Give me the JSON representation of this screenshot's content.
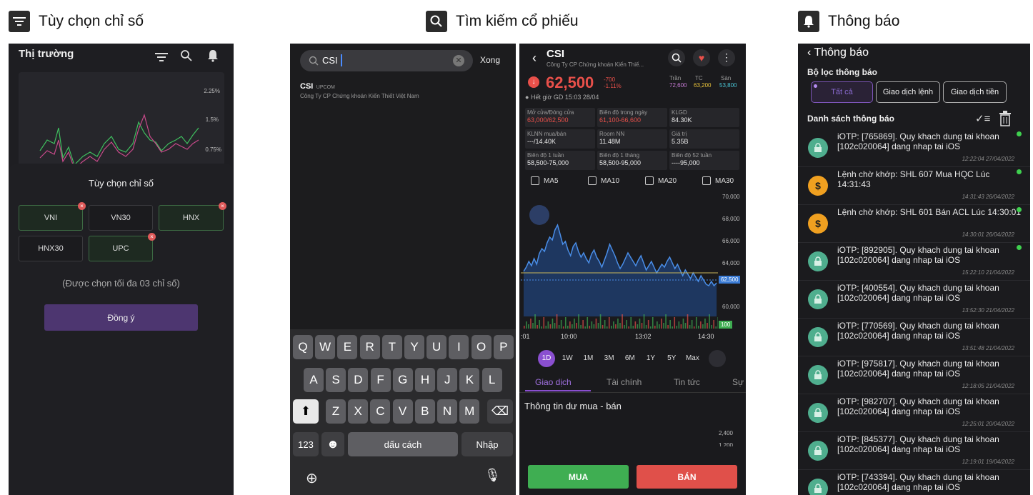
{
  "headers": {
    "h1": "Tùy chọn chỉ số",
    "h2": "Tìm kiếm cổ phiếu",
    "h3": "Thông báo"
  },
  "p1": {
    "title": "Thị trường",
    "axis": [
      "2.25%",
      "1.5%",
      "0.75%"
    ],
    "sheet_title": "Tùy chọn chỉ số",
    "chips": [
      "VNI",
      "VN30",
      "HNX",
      "HNX30",
      "UPC"
    ],
    "remove_mark": "×",
    "hint": "(Được chọn tối đa 03 chỉ số)",
    "confirm": "Đồng ý"
  },
  "p2": {
    "search_value": "CSI",
    "done": "Xong",
    "result_code": "CSI",
    "result_exchange": "UPCOM",
    "result_name": "Công Ty CP Chứng khoán Kiến Thiết Việt Nam",
    "row1": [
      "Q",
      "W",
      "E",
      "R",
      "T",
      "Y",
      "U",
      "I",
      "O",
      "P"
    ],
    "row2": [
      "A",
      "S",
      "D",
      "F",
      "G",
      "H",
      "J",
      "K",
      "L"
    ],
    "row3": [
      "Z",
      "X",
      "C",
      "V",
      "B",
      "N",
      "M"
    ],
    "num": "123",
    "space": "dấu cách",
    "enter": "Nhập"
  },
  "p3": {
    "code": "CSI",
    "company": "Công Ty CP Chứng khoán Kiến Thiế...",
    "price": "62,500",
    "chg": "-700",
    "pct": "-1.11%",
    "tran_l": "Trần",
    "tran": "72,600",
    "tc_l": "TC",
    "tc": "63,200",
    "san_l": "Sàn",
    "san": "53,800",
    "hours": "Hết giờ GD 15:03 28/04",
    "cells": [
      [
        "Mở cửa/Đóng cửa",
        "63,000/62,500"
      ],
      [
        "Biên độ trong ngày",
        "61,100-66,600"
      ],
      [
        "KLGD",
        "84.30K"
      ],
      [
        "KLNN mua/bán",
        "---/14.40K"
      ],
      [
        "Room NN",
        "11.48M"
      ],
      [
        "Giá trị",
        "5.35B"
      ],
      [
        "Biên độ 1 tuần",
        "58,500-75,000"
      ],
      [
        "Biên độ 1 tháng",
        "58,500-95,000"
      ],
      [
        "Biên độ 52 tuần",
        "----95,000"
      ]
    ],
    "ma": [
      "MA5",
      "MA10",
      "MA20",
      "MA30"
    ],
    "yaxis": [
      "70,000",
      "68,000",
      "66,000",
      "64,000",
      "62,500",
      "60,000",
      "100"
    ],
    "xaxis": [
      ":01",
      "10:00",
      "13:02",
      "14:30"
    ],
    "ranges": [
      "1D",
      "1W",
      "1M",
      "3M",
      "6M",
      "1Y",
      "5Y",
      "Max"
    ],
    "tabs": [
      "Giao dịch",
      "Tài chính",
      "Tin tức",
      "Sự"
    ],
    "section": "Thông tin dư mua - bán",
    "depth_axis": [
      "2,400",
      "1,200"
    ],
    "buy": "MUA",
    "sell": "BÁN"
  },
  "p4": {
    "back": "Thông báo",
    "filter_title": "Bộ lọc thông báo",
    "filters": [
      "Tất cả",
      "Giao dịch lệnh",
      "Giao dịch tiền"
    ],
    "list_title": "Danh sách thông báo",
    "items": [
      {
        "icon": "lock",
        "text": "iOTP: [765869]. Quy khach dung tai khoan [102c020064] dang nhap tai iOS",
        "time": "12:22:04 27/04/2022",
        "dot": true
      },
      {
        "icon": "dollar",
        "text": "Lệnh chờ khớp: SHL 607 Mua HQC Lúc 14:31:43",
        "time": "14:31:43 26/04/2022",
        "dot": true
      },
      {
        "icon": "dollar",
        "text": "Lệnh chờ khớp: SHL 601 Bán ACL Lúc 14:30:01",
        "time": "14:30:01 26/04/2022",
        "dot": true
      },
      {
        "icon": "lock",
        "text": "iOTP: [892905]. Quy khach dung tai khoan [102c020064] dang nhap tai iOS",
        "time": "15:22:10 21/04/2022",
        "dot": true
      },
      {
        "icon": "lock",
        "text": "iOTP: [400554]. Quy khach dung tai khoan [102c020064] dang nhap tai iOS",
        "time": "13:52:30 21/04/2022",
        "dot": false
      },
      {
        "icon": "lock",
        "text": "iOTP: [770569]. Quy khach dung tai khoan [102c020064] dang nhap tai iOS",
        "time": "13:51:48 21/04/2022",
        "dot": false
      },
      {
        "icon": "lock",
        "text": "iOTP: [975817]. Quy khach dung tai khoan [102c020064] dang nhap tai iOS",
        "time": "12:18:05 21/04/2022",
        "dot": false
      },
      {
        "icon": "lock",
        "text": "iOTP: [982707]. Quy khach dung tai khoan [102c020064] dang nhap tai iOS",
        "time": "12:25:01 20/04/2022",
        "dot": false
      },
      {
        "icon": "lock",
        "text": "iOTP: [845377]. Quy khach dung tai khoan [102c020064] dang nhap tai iOS",
        "time": "12:19:01 19/04/2022",
        "dot": false
      },
      {
        "icon": "lock",
        "text": "iOTP: [743394]. Quy khach dung tai khoan [102c020064] dang nhap tai iOS",
        "time": "",
        "dot": false
      }
    ]
  },
  "colors": {
    "green": "#3fbf5f",
    "red": "#e8504a",
    "purple": "#5a3c86",
    "teal": "#4fae8e",
    "orange": "#f0a020"
  }
}
